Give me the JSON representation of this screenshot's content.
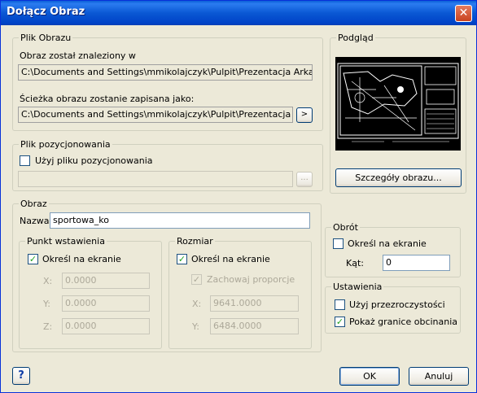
{
  "window": {
    "title": "Dołącz Obraz",
    "close_label": "✕"
  },
  "file_group": {
    "legend": "Plik Obrazu",
    "found_label": "Obraz został znaleziony w",
    "found_path": "C:\\Documents and Settings\\mmikolajczyk\\Pulpit\\Prezentacja Arkadia OZC-",
    "save_label": "Ścieżka obrazu zostanie zapisana jako:",
    "save_path": "C:\\Documents and Settings\\mmikolajczyk\\Pulpit\\Prezentacja Arkadia",
    "browse_label": ">"
  },
  "preview_group": {
    "legend": "Podgląd",
    "details_label": "Szczegóły obrazu..."
  },
  "positioning_group": {
    "legend": "Plik pozycjonowania",
    "use_label": "Użyj pliku pozycjonowania",
    "use_checked": false,
    "path": "",
    "browse_label": "..."
  },
  "image_group": {
    "legend": "Obraz",
    "name_label": "Nazwa",
    "name_value": "sportowa_ko"
  },
  "insert_group": {
    "legend": "Punkt wstawienia",
    "specify_label": "Określ na ekranie",
    "specify_checked": true,
    "x_label": "X:",
    "x_value": "0.0000",
    "y_label": "Y:",
    "y_value": "0.0000",
    "z_label": "Z:",
    "z_value": "0.0000"
  },
  "size_group": {
    "legend": "Rozmiar",
    "specify_label": "Określ na ekranie",
    "specify_checked": true,
    "proportion_label": "Zachowaj proporcje",
    "proportion_checked": true,
    "x_label": "X:",
    "x_value": "9641.0000",
    "y_label": "Y:",
    "y_value": "6484.0000"
  },
  "rotation_group": {
    "legend": "Obrót",
    "specify_label": "Określ na ekranie",
    "specify_checked": false,
    "angle_label": "Kąt:",
    "angle_value": "0"
  },
  "settings_group": {
    "legend": "Ustawienia",
    "transparency_label": "Użyj przezroczystości",
    "transparency_checked": false,
    "clip_label": "Pokaż granice obcinania",
    "clip_checked": true
  },
  "footer": {
    "help_label": "?",
    "ok_label": "OK",
    "cancel_label": "Anuluj"
  }
}
